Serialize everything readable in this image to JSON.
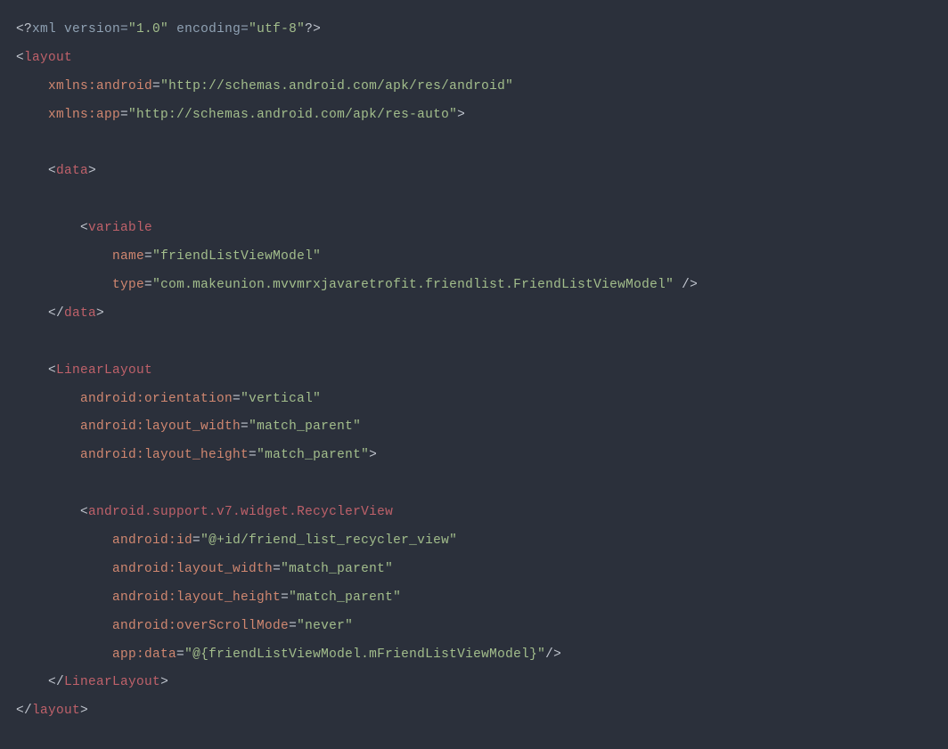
{
  "code": {
    "l1": {
      "open": "<?",
      "pi": "xml version=",
      "v1": "\"1.0\"",
      "sp1": " ",
      "enc": "encoding=",
      "v2": "\"utf-8\"",
      "close": "?>"
    },
    "l2": {
      "lt": "<",
      "tag": "layout"
    },
    "l3": {
      "attr": "xmlns:android",
      "eq": "=",
      "val": "\"http://schemas.android.com/apk/res/android\""
    },
    "l4": {
      "attr": "xmlns:app",
      "eq": "=",
      "val": "\"http://schemas.android.com/apk/res-auto\"",
      "gt": ">"
    },
    "l5": {
      "lt": "<",
      "tag": "data",
      "gt": ">"
    },
    "l6": {
      "lt": "<",
      "tag": "variable"
    },
    "l7": {
      "attr": "name",
      "eq": "=",
      "val": "\"friendListViewModel\""
    },
    "l8": {
      "attr": "type",
      "eq": "=",
      "val": "\"com.makeunion.mvvmrxjavaretrofit.friendlist.FriendListViewModel\"",
      "close": " />"
    },
    "l9": {
      "lt": "</",
      "tag": "data",
      "gt": ">"
    },
    "l10": {
      "lt": "<",
      "tag": "LinearLayout"
    },
    "l11": {
      "attr": "android:orientation",
      "eq": "=",
      "val": "\"vertical\""
    },
    "l12": {
      "attr": "android:layout_width",
      "eq": "=",
      "val": "\"match_parent\""
    },
    "l13": {
      "attr": "android:layout_height",
      "eq": "=",
      "val": "\"match_parent\"",
      "gt": ">"
    },
    "l14": {
      "lt": "<",
      "tag": "android.support.v7.widget.RecyclerView"
    },
    "l15": {
      "attr": "android:id",
      "eq": "=",
      "val": "\"@+id/friend_list_recycler_view\""
    },
    "l16": {
      "attr": "android:layout_width",
      "eq": "=",
      "val": "\"match_parent\""
    },
    "l17": {
      "attr": "android:layout_height",
      "eq": "=",
      "val": "\"match_parent\""
    },
    "l18": {
      "attr": "android:overScrollMode",
      "eq": "=",
      "val": "\"never\""
    },
    "l19": {
      "attr": "app:data",
      "eq": "=",
      "val": "\"@{friendListViewModel.mFriendListViewModel}\"",
      "close": "/>"
    },
    "l20": {
      "lt": "</",
      "tag": "LinearLayout",
      "gt": ">"
    },
    "l21": {
      "lt": "</",
      "tag": "layout",
      "gt": ">"
    }
  }
}
